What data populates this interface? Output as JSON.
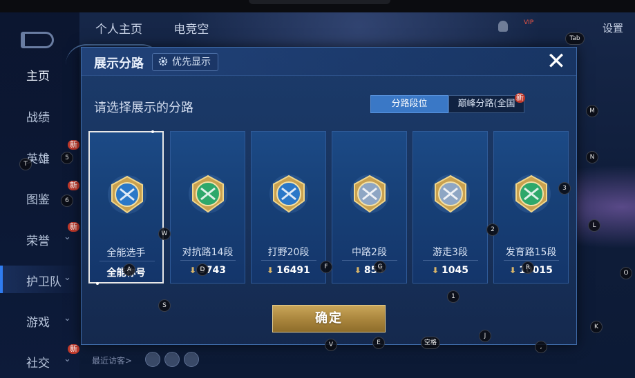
{
  "nav": {
    "tabs": [
      "个人主页",
      "电竞空"
    ],
    "settings": "设置",
    "vip": "VIP",
    "recent": "最近访客>",
    "items": [
      {
        "label": "主页",
        "new": "",
        "chev": ""
      },
      {
        "label": "战绩",
        "new": "",
        "chev": ""
      },
      {
        "label": "英雄",
        "new": "新",
        "chev": ""
      },
      {
        "label": "图鉴",
        "new": "新",
        "chev": ""
      },
      {
        "label": "荣誉",
        "new": "新",
        "chev": "⌄"
      },
      {
        "label": "护卫队",
        "new": "",
        "chev": "⌄"
      },
      {
        "label": "游戏",
        "new": "",
        "chev": "⌄"
      },
      {
        "label": "社交",
        "new": "新",
        "chev": "⌄"
      }
    ]
  },
  "modal": {
    "title": "展示分路",
    "priority_button": "优先显示",
    "close_icon": "close-icon",
    "subtitle": "请选择展示的分路",
    "segments": {
      "rank": "分路段位",
      "peak": "巅峰分路(全国",
      "new": "新"
    },
    "cards": [
      {
        "name": "全能选手",
        "score": "全能称号",
        "has_arrow": false,
        "selected": true,
        "emblem": "allround-emblem",
        "color": "#2b78c8"
      },
      {
        "name": "对抗路14段",
        "score": "9743",
        "has_arrow": true,
        "selected": false,
        "emblem": "clash-lane-emblem",
        "color": "#2ea86b"
      },
      {
        "name": "打野20段",
        "score": "16491",
        "has_arrow": true,
        "selected": false,
        "emblem": "jungle-emblem",
        "color": "#2b78c8"
      },
      {
        "name": "中路2段",
        "score": "855",
        "has_arrow": true,
        "selected": false,
        "emblem": "mid-lane-emblem",
        "color": "#8ea6c4"
      },
      {
        "name": "游走3段",
        "score": "1045",
        "has_arrow": true,
        "selected": false,
        "emblem": "roam-emblem",
        "color": "#8ea6c4"
      },
      {
        "name": "发育路15段",
        "score": "10015",
        "has_arrow": true,
        "selected": false,
        "emblem": "farm-lane-emblem",
        "color": "#2ea86b"
      }
    ],
    "confirm": "确定"
  },
  "hotkeys": [
    "Tab",
    "M",
    "N",
    "L",
    "O",
    "K",
    "3",
    "2",
    "1",
    "J",
    "5",
    "6",
    "T",
    "W",
    "S",
    "V",
    "E",
    "空格",
    "F",
    "G",
    "D",
    "A",
    "R",
    ","
  ]
}
